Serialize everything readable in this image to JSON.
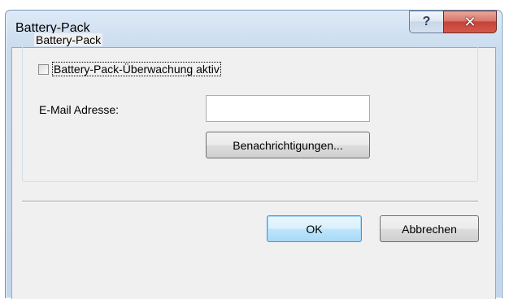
{
  "window": {
    "title": "Battery-Pack",
    "help_glyph": "?",
    "close_glyph": "✕"
  },
  "group": {
    "title": "Battery-Pack",
    "checkbox_label": "Battery-Pack-Überwachung aktiv",
    "checkbox_checked": false,
    "email_label": "E-Mail Adresse:",
    "email_value": "",
    "notifications_button": "Benachrichtigungen..."
  },
  "footer": {
    "ok_label": "OK",
    "cancel_label": "Abbrechen"
  }
}
